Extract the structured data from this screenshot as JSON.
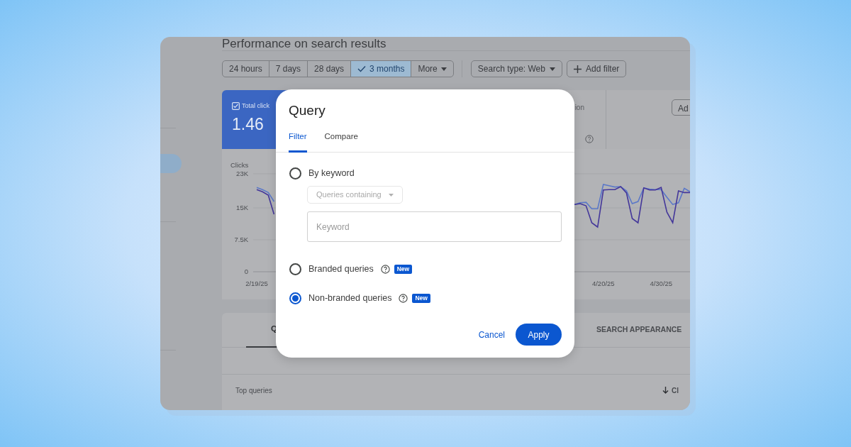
{
  "page": {
    "title": "Performance on search results"
  },
  "date_ranges": [
    {
      "label": "24 hours",
      "selected": false
    },
    {
      "label": "7 days",
      "selected": false
    },
    {
      "label": "28 days",
      "selected": false
    },
    {
      "label": "3 months",
      "selected": true
    },
    {
      "label": "More",
      "selected": false,
      "kind": "menu"
    }
  ],
  "filters": [
    {
      "label": "Search type: Web",
      "kind": "dropdown"
    },
    {
      "label": "Add filter",
      "kind": "add"
    }
  ],
  "total_clicks_card": {
    "label": "Total click",
    "value": "1.46",
    "checked": true
  },
  "second_card": {
    "label": "ion"
  },
  "third_card": {
    "button": "Ad"
  },
  "chart": {
    "chart_data": {
      "type": "line",
      "ylabel": "Clicks",
      "categories": [
        "2/19/25",
        null,
        null,
        null,
        null,
        null,
        null,
        null,
        null,
        null,
        null,
        null,
        null,
        null,
        null,
        null,
        null,
        null,
        null,
        null,
        null,
        null,
        null,
        null,
        null,
        null,
        null,
        null,
        null,
        null,
        null,
        null,
        null,
        null,
        null,
        null,
        null,
        null,
        null,
        null,
        null,
        null,
        null,
        null,
        null,
        null,
        null,
        null,
        null,
        null,
        null,
        null,
        null,
        null,
        null,
        null,
        null,
        null,
        null,
        null,
        "4/20/25",
        null,
        null,
        null,
        null,
        null,
        null,
        null,
        null,
        null,
        "4/30/25",
        null,
        null,
        null,
        null,
        null
      ],
      "series": [
        {
          "color": "#44379a",
          "values": [
            19300,
            18800,
            18000,
            13500,
            null,
            null,
            null,
            null,
            null,
            null,
            null,
            null,
            null,
            null,
            null,
            null,
            null,
            null,
            null,
            null,
            null,
            null,
            null,
            null,
            null,
            null,
            null,
            null,
            null,
            null,
            null,
            null,
            null,
            null,
            null,
            null,
            null,
            null,
            null,
            null,
            null,
            null,
            null,
            null,
            null,
            null,
            null,
            null,
            null,
            null,
            null,
            null,
            null,
            null,
            null,
            15800,
            16000,
            15500,
            11500,
            10500,
            19200,
            19300,
            19300,
            20000,
            18500,
            12500,
            11500,
            19700,
            19200,
            19200,
            19800,
            14000,
            11500,
            19000,
            18600,
            18600
          ]
        },
        {
          "color": "#5b78c8",
          "values": [
            19800,
            19300,
            18600,
            16500,
            null,
            null,
            null,
            null,
            null,
            null,
            null,
            null,
            null,
            null,
            null,
            null,
            null,
            null,
            null,
            null,
            null,
            null,
            null,
            null,
            null,
            null,
            null,
            null,
            null,
            null,
            null,
            null,
            null,
            null,
            null,
            null,
            null,
            null,
            null,
            null,
            null,
            null,
            null,
            null,
            null,
            null,
            null,
            null,
            null,
            null,
            null,
            null,
            null,
            null,
            null,
            15800,
            16200,
            16300,
            14800,
            14800,
            20500,
            20200,
            19900,
            20000,
            19000,
            16000,
            16500,
            19700,
            19400,
            19300,
            19300,
            17500,
            15800,
            16200,
            19600,
            18800
          ]
        }
      ],
      "ylim": [
        0,
        23000
      ],
      "yticks": [
        {
          "value": 0,
          "label": "0"
        },
        {
          "value": 7500,
          "label": "7.5K"
        },
        {
          "value": 15000,
          "label": "15K"
        },
        {
          "value": 23000,
          "label": "23K"
        }
      ]
    }
  },
  "table_tabs": [
    {
      "label": "Q",
      "selected": true
    },
    {
      "label": "SEARCH APPEARANCE",
      "selected": false
    }
  ],
  "table": {
    "title": "Top queries",
    "column_1": "Cl"
  },
  "dialog": {
    "title": "Query",
    "tabs": [
      {
        "label": "Filter",
        "selected": true
      },
      {
        "label": "Compare",
        "selected": false
      }
    ],
    "options": [
      {
        "label": "By keyword",
        "selected": false,
        "match": {
          "label": "Queries containing",
          "disabled": true
        },
        "input": {
          "placeholder": "Keyword"
        }
      },
      {
        "label": "Branded queries",
        "selected": false,
        "help": true,
        "badge": "New"
      },
      {
        "label": "Non-branded queries",
        "selected": true,
        "help": true,
        "badge": "New"
      }
    ],
    "actions": [
      {
        "label": "Cancel",
        "kind": "text"
      },
      {
        "label": "Apply",
        "kind": "filled"
      }
    ]
  }
}
